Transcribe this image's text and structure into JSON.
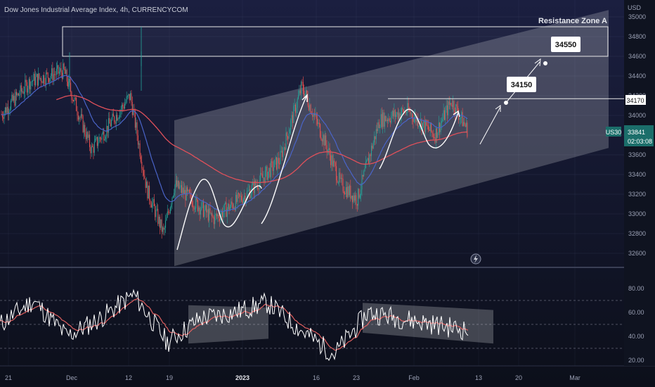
{
  "header": {
    "title": "Dow Jones Industrial Average Index, 4h, CURRENCYCOM"
  },
  "price_axis": {
    "unit": "USD",
    "ticks": [
      "35000",
      "34800",
      "34600",
      "34400",
      "34200",
      "34000",
      "33800",
      "33600",
      "33400",
      "33200",
      "33000",
      "32800",
      "32600"
    ],
    "level_label": "34170",
    "symbol_badge": "US30",
    "last_price": "33841",
    "countdown": "02:03:08"
  },
  "rsi_axis": {
    "ticks": [
      "80.00",
      "60.00",
      "40.00",
      "20.00"
    ]
  },
  "time_axis": {
    "ticks": [
      "21",
      "Dec",
      "12",
      "19",
      "2023",
      "16",
      "23",
      "Feb",
      "13",
      "20",
      "Mar"
    ]
  },
  "annotations": {
    "zone_label": "Resistance Zone A",
    "target1": "34150",
    "target2": "34550"
  },
  "colors": {
    "background_top": "#1a1e3c",
    "background_bottom": "#0c0f1a",
    "bull": "#26a69a",
    "bear": "#ef5350",
    "ema_fast": "#4a64c8",
    "ema_slow": "#e0505a",
    "rsi_line": "#ffffff",
    "rsi_signal": "#e06060"
  },
  "chart_data": {
    "type": "candlestick",
    "symbol": "US30",
    "timeframe": "4h",
    "price_range": [
      32480,
      35080
    ],
    "key_price_path": [
      {
        "date": "2022-11-14",
        "close": 33600
      },
      {
        "date": "2022-11-18",
        "close": 33900
      },
      {
        "date": "2022-11-25",
        "close": 34350
      },
      {
        "date": "2022-12-01",
        "close": 34450
      },
      {
        "date": "2022-12-06",
        "close": 33650
      },
      {
        "date": "2022-12-13",
        "close": 34200
      },
      {
        "date": "2022-12-16",
        "close": 33250
      },
      {
        "date": "2022-12-19",
        "close": 32800
      },
      {
        "date": "2022-12-21",
        "close": 33300
      },
      {
        "date": "2022-12-28",
        "close": 32950
      },
      {
        "date": "2023-01-03",
        "close": 33200
      },
      {
        "date": "2023-01-09",
        "close": 33550
      },
      {
        "date": "2023-01-13",
        "close": 34300
      },
      {
        "date": "2023-01-17",
        "close": 33750
      },
      {
        "date": "2023-01-20",
        "close": 33300
      },
      {
        "date": "2023-01-23",
        "close": 33150
      },
      {
        "date": "2023-01-27",
        "close": 33950
      },
      {
        "date": "2023-02-01",
        "close": 34050
      },
      {
        "date": "2023-02-06",
        "close": 33800
      },
      {
        "date": "2023-02-09",
        "close": 34150
      },
      {
        "date": "2023-02-12",
        "close": 33841
      }
    ],
    "resistance_line": 34170,
    "resistance_zone": [
      34600,
      34900
    ],
    "targets": [
      34150,
      34550
    ],
    "rsi": {
      "ylim": [
        15,
        85
      ],
      "levels": [
        70,
        50,
        30
      ],
      "approx_path": [
        50,
        70,
        40,
        55,
        75,
        35,
        55,
        60,
        68,
        45,
        25,
        60,
        55,
        50,
        45
      ]
    }
  }
}
